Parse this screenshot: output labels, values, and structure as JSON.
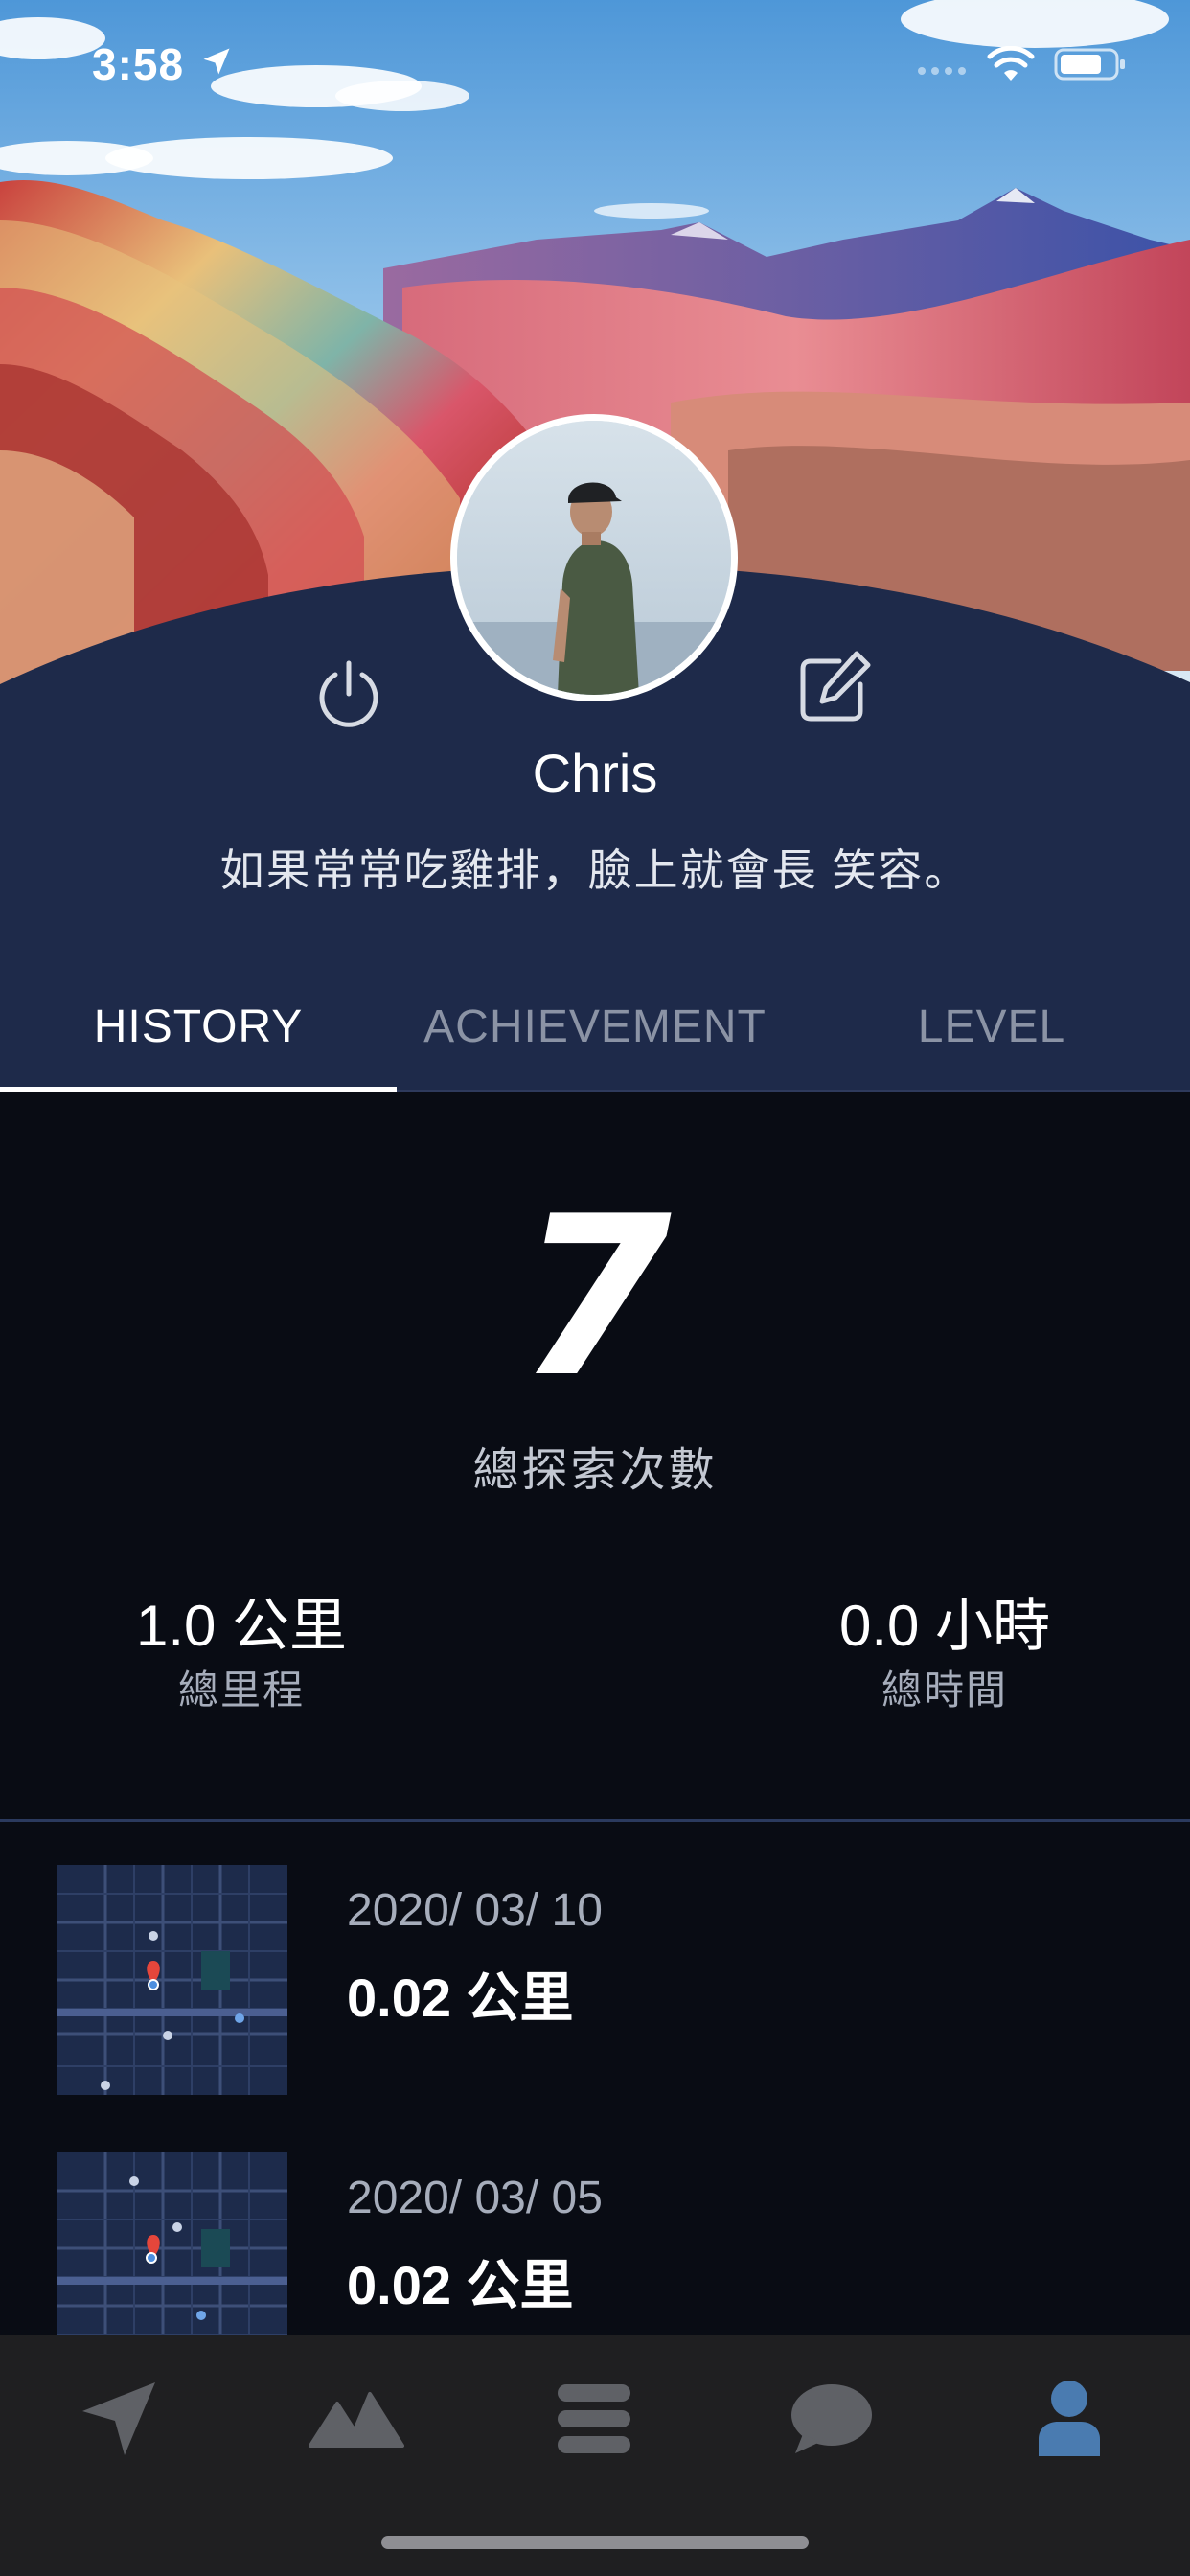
{
  "status_bar": {
    "time": "3:58"
  },
  "profile": {
    "name": "Chris",
    "bio": "如果常常吃雞排，臉上就會長 笑容。"
  },
  "tabs": [
    {
      "label": "HISTORY",
      "active": true
    },
    {
      "label": "ACHIEVEMENT",
      "active": false
    },
    {
      "label": "LEVEL",
      "active": false
    }
  ],
  "summary": {
    "total_count": "7",
    "total_count_label": "總探索次數",
    "distance_value": "1.0 公里",
    "distance_label": "總里程",
    "time_value": "0.0 小時",
    "time_label": "總時間"
  },
  "history": [
    {
      "date": "2020/ 03/ 10",
      "distance": "0.02 公里"
    },
    {
      "date": "2020/ 03/ 05",
      "distance": "0.02 公里"
    }
  ],
  "bottom_nav": [
    {
      "icon": "location-arrow-icon",
      "active": false
    },
    {
      "icon": "mountains-icon",
      "active": false
    },
    {
      "icon": "list-icon",
      "active": false
    },
    {
      "icon": "chat-bubble-icon",
      "active": false
    },
    {
      "icon": "user-icon",
      "active": true
    }
  ],
  "colors": {
    "header_bg": "#1e2a4a",
    "content_bg": "#090c14",
    "nav_bg": "#1f1f21",
    "nav_active": "#4a7bb0",
    "nav_inactive": "#5f6166"
  }
}
